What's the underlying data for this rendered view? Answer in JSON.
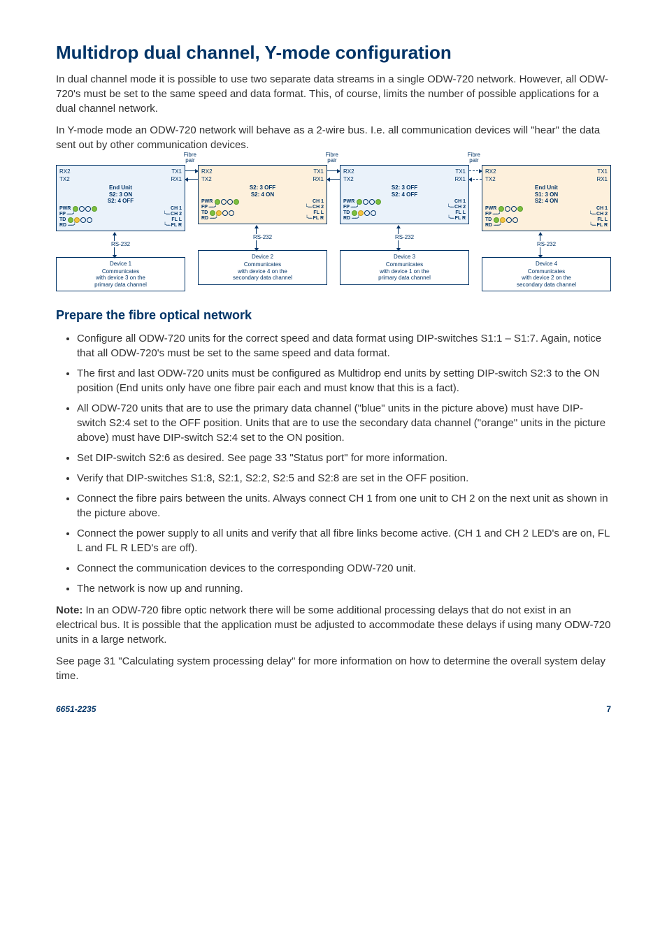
{
  "title": "Multidrop dual channel, Y-mode configuration",
  "intro1": "In dual channel mode it is possible to use two separate data streams in a single ODW-720 network. However, all ODW-720's must be set to the same speed and data format. This, of course, limits the number of possible applications for a dual channel network.",
  "intro2": "In Y-mode mode an ODW-720 network will behave as a 2-wire bus. I.e. all communication devices will \"hear\" the data sent out by other communication devices.",
  "diagram": {
    "fibre_label": "Fibre\npair",
    "ports": {
      "rx2": "RX2",
      "tx1": "TX1",
      "tx2": "TX2",
      "rx1": "RX1"
    },
    "leds": {
      "pwr": "PWR",
      "fp": "FP",
      "td": "TD",
      "rd": "RD",
      "ch1": "CH 1",
      "ch2": "CH 2",
      "fll": "FL L",
      "flr": "FL R"
    },
    "rs232": "RS-232",
    "units": [
      {
        "tint": "blue",
        "config": [
          "End Unit",
          "S2: 3 ON",
          "S2: 4 OFF"
        ],
        "device_title": "Device 1",
        "device_desc": [
          "Communicates",
          "with device 3 on the",
          "primary data channel"
        ],
        "fibre_after": true,
        "dashed_after": false
      },
      {
        "tint": "orange",
        "config": [
          "S2: 3 OFF",
          "S2: 4 ON"
        ],
        "device_title": "Device 2",
        "device_desc": [
          "Communicates",
          "with device 4 on the",
          "secondary data channel"
        ],
        "fibre_after": true,
        "dashed_after": false
      },
      {
        "tint": "blue",
        "config": [
          "S2: 3 OFF",
          "S2: 4 OFF"
        ],
        "device_title": "Device 3",
        "device_desc": [
          "Communicates",
          "with device 1 on the",
          "primary data channel"
        ],
        "fibre_after": true,
        "dashed_after": true
      },
      {
        "tint": "orange",
        "config": [
          "End Unit",
          "S1: 3 ON",
          "S2: 4 ON"
        ],
        "device_title": "Device 4",
        "device_desc": [
          "Communicates",
          "with device 2 on the",
          "secondary data channel"
        ],
        "fibre_after": false,
        "dashed_after": false
      }
    ]
  },
  "section2_title": "Prepare the fibre optical network",
  "bullets": [
    "Configure all ODW-720 units for the correct speed and data format using DIP-switches S1:1 – S1:7. Again, notice that all ODW-720's must be set to the same speed and data format.",
    "The first and last ODW-720 units must be configured as Multidrop end units by setting DIP-switch S2:3 to the ON position (End units only have one fibre pair each and must know that this is a fact).",
    "All ODW-720 units that are to use the primary data channel (\"blue\" units in the picture above) must have DIP-switch S2:4 set to the OFF position. Units that are to use the secondary data channel (\"orange\" units in the picture above) must have DIP-switch S2:4 set to the ON position.",
    "Set DIP-switch S2:6 as desired.  See page 33 \"Status port\" for more information.",
    "Verify that DIP-switches S1:8, S2:1, S2:2, S2:5 and S2:8 are set in the OFF position.",
    "Connect the fibre pairs between the units. Always connect CH 1 from one unit to CH 2 on the next unit as shown in the picture above.",
    "Connect the power supply to all units and verify that all fibre links become active. (CH 1 and CH 2 LED's are on, FL L and FL R LED's are off).",
    "Connect the communication devices to the corresponding ODW-720 unit.",
    " The network is now up and running."
  ],
  "note_label": "Note:",
  "note_text": "  In an ODW-720 fibre optic network there will be some additional processing delays that do not exist in an electrical bus. It is possible that the application must be adjusted to accommodate these delays if using many ODW-720 units in a large network.",
  "closing": "See page 31 \"Calculating system processing delay\" for more information on how to determine the overall system delay time.",
  "footer_left": "6651-2235",
  "footer_right": "7"
}
